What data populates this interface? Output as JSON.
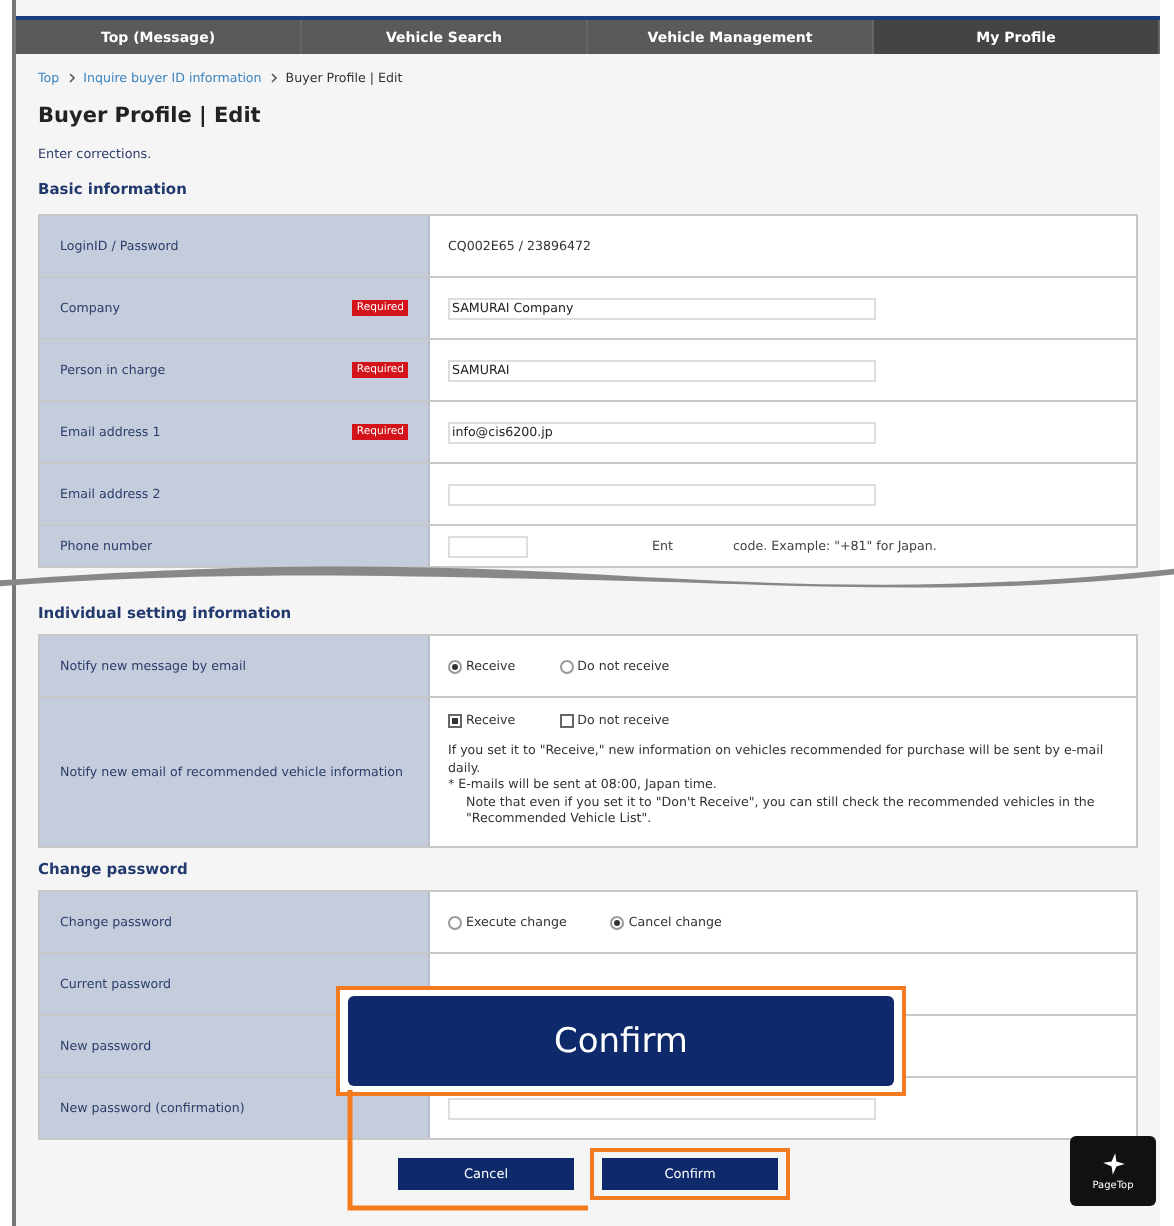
{
  "nav": [
    {
      "label": "Top (Message)",
      "selected": false
    },
    {
      "label": "Vehicle Search",
      "selected": false
    },
    {
      "label": "Vehicle Management",
      "selected": false
    },
    {
      "label": "My Profile",
      "selected": true
    }
  ],
  "breadcrumb": [
    {
      "label": "Top",
      "link": true
    },
    {
      "label": "Inquire buyer ID information",
      "link": true
    },
    {
      "label": "Buyer Profile | Edit",
      "link": false
    }
  ],
  "title": "Buyer Profile | Edit",
  "intro": "Enter corrections.",
  "sections": [
    {
      "heading": "Basic information",
      "rows": [
        {
          "label": "LoginID / Password",
          "kind": "text",
          "value": "CQ002E65 / 23896472"
        },
        {
          "label": "Company",
          "badge": "Required",
          "kind": "input",
          "value": "SAMURAI Company"
        },
        {
          "label": "Person in charge",
          "badge": "Required",
          "kind": "input",
          "value": "SAMURAI"
        },
        {
          "label": "Email address 1",
          "badge": "Required",
          "kind": "input",
          "value": "info@cis6200.jp"
        },
        {
          "label": "Email address 2",
          "kind": "input",
          "value": ""
        },
        {
          "label": "Phone number",
          "kind": "phone",
          "hint_start": "Ent",
          "hint_end": "code. Example: \"+81\" for Japan."
        }
      ]
    },
    {
      "heading": "Individual setting information",
      "rows": [
        {
          "label": "Notify new message by email",
          "kind": "radio",
          "options": [
            {
              "label": "Receive",
              "selected": true
            },
            {
              "label": "Do not receive",
              "selected": false
            }
          ]
        },
        {
          "label": "Notify new email of recommended vehicle information",
          "kind": "checkbox",
          "options": [
            {
              "label": "Receive",
              "selected": true
            },
            {
              "label": "Do not receive",
              "selected": false
            }
          ],
          "notes": [
            "If you set it to \"Receive,\" new information on vehicles recommended for purchase will be sent by e-mail daily.",
            "* E-mails will be sent at 08:00, Japan time.",
            "Note that even if you set it to \"Don't Receive\", you can still check the recommended vehicles in the \"Recommended Vehicle List\"."
          ]
        }
      ]
    },
    {
      "heading": "Change password",
      "rows": [
        {
          "label": "Change password",
          "kind": "radio",
          "options": [
            {
              "label": "Execute change",
              "selected": false
            },
            {
              "label": "Cancel change",
              "selected": true
            }
          ]
        },
        {
          "label": "Current password",
          "kind": "covered"
        },
        {
          "label": "New password",
          "kind": "covered"
        },
        {
          "label": "New password (confirmation)",
          "kind": "input",
          "value": ""
        }
      ]
    }
  ],
  "buttons": [
    {
      "label": "Cancel",
      "highlighted": false
    },
    {
      "label": "Confirm",
      "highlighted": true
    }
  ],
  "callout": {
    "label": "Confirm"
  },
  "page_top": {
    "label": "PageTop"
  }
}
